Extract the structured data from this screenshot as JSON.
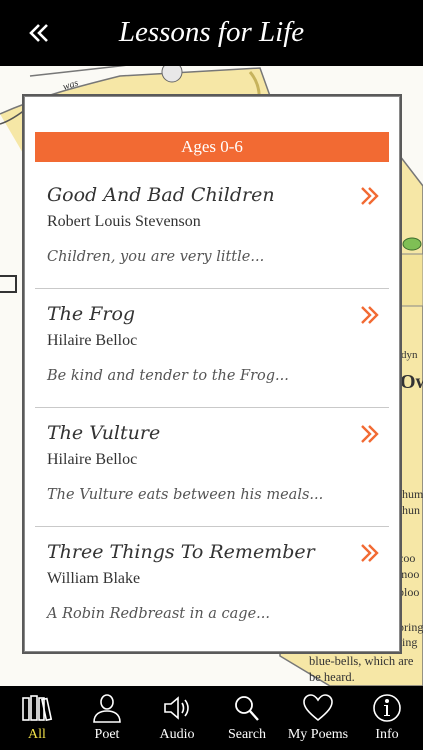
{
  "header": {
    "title": "Lessons for Life",
    "back_icon": "double-chevron-left-icon"
  },
  "background": {
    "snippets": [
      "was",
      "Ow",
      "hum",
      "hun",
      "coo",
      "moo",
      "bloo",
      "pring",
      "ring",
      "blue-bells, which are",
      "be heard.",
      "dyn"
    ]
  },
  "section": {
    "label": "Ages 0-6",
    "accent": "#f26a33"
  },
  "poems": [
    {
      "title": "Good And Bad Children",
      "poet": "Robert Louis Stevenson",
      "excerpt": "Children, you are very little..."
    },
    {
      "title": "The Frog",
      "poet": "Hilaire Belloc",
      "excerpt": "Be kind and tender to the Frog..."
    },
    {
      "title": "The Vulture",
      "poet": "Hilaire Belloc",
      "excerpt": "The Vulture eats between his meals..."
    },
    {
      "title": "Three Things To Remember",
      "poet": "William Blake",
      "excerpt": "A Robin Redbreast in a cage..."
    }
  ],
  "tabs": [
    {
      "label": "All",
      "icon": "books-icon",
      "active": true
    },
    {
      "label": "Poet",
      "icon": "person-icon",
      "active": false
    },
    {
      "label": "Audio",
      "icon": "speaker-icon",
      "active": false
    },
    {
      "label": "Search",
      "icon": "search-icon",
      "active": false
    },
    {
      "label": "My Poems",
      "icon": "heart-icon",
      "active": false
    },
    {
      "label": "Info",
      "icon": "info-icon",
      "active": false
    }
  ]
}
